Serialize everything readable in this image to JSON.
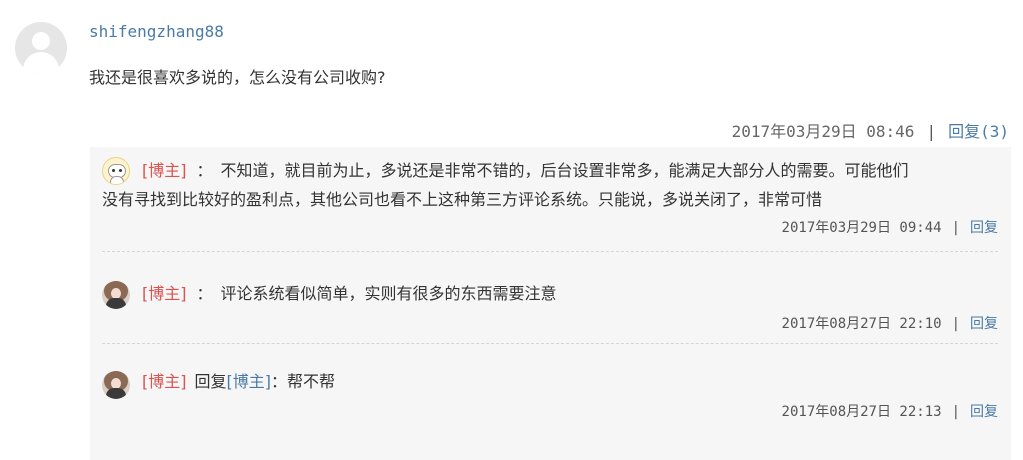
{
  "comment": {
    "username": "shifengzhang88",
    "text": "我还是很喜欢多说的，怎么没有公司收购?",
    "timestamp": "2017年03月29日 08:46",
    "separator": "|",
    "reply_label": "回复(3)"
  },
  "replies": [
    {
      "author_tag": "[博主]",
      "colon": "：",
      "text_line1": "不知道，就目前为止，多说还是非常不错的，后台设置非常多，能满足大部分人的需要。可能他们",
      "text_line2": "没有寻找到比较好的盈利点，其他公司也看不上这种第三方评论系统。只能说，多说关闭了，非常可惜",
      "timestamp": "2017年03月29日 09:44",
      "separator": "|",
      "reply_label": "回复"
    },
    {
      "author_tag": "[博主]",
      "colon": "：",
      "text": "评论系统看似简单，实则有很多的东西需要注意",
      "timestamp": "2017年08月27日 22:10",
      "separator": "|",
      "reply_label": "回复"
    },
    {
      "author_tag": "[博主]",
      "reply_to_prefix": "回复",
      "reply_to_tag": "[博主]",
      "colon": "：",
      "text": "帮不帮",
      "timestamp": "2017年08月27日 22:13",
      "separator": "|",
      "reply_label": "回复"
    }
  ],
  "icons": {
    "main_avatar": "default-user-avatar-icon",
    "reply1_avatar": "robot-avatar-icon",
    "reply2_avatar": "photo-avatar-icon",
    "reply3_avatar": "photo-avatar-icon"
  },
  "colors": {
    "link": "#4a7ba7",
    "tag": "#d9534f",
    "reply_bg": "#f6f6f6"
  }
}
